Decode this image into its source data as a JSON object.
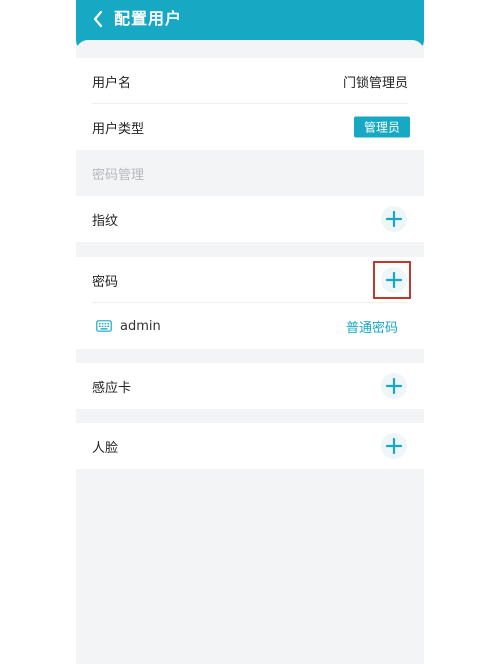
{
  "header": {
    "title": "配置用户",
    "back_icon": "chevron-left-icon"
  },
  "user_info": {
    "name_label": "用户名",
    "name_value": "门锁管理员",
    "type_label": "用户类型",
    "type_value": "管理员"
  },
  "password_management": {
    "section_title": "密码管理",
    "items": [
      {
        "label": "指纹",
        "action_icon": "plus-icon"
      },
      {
        "label": "密码",
        "action_icon": "plus-icon",
        "highlighted": true
      },
      {
        "label": "感应卡",
        "action_icon": "plus-icon"
      },
      {
        "label": "人脸",
        "action_icon": "plus-icon"
      }
    ],
    "password_entries": [
      {
        "icon": "keyboard-icon",
        "name": "admin",
        "type": "普通密码"
      }
    ]
  },
  "colors": {
    "accent": "#17a9c4",
    "background": "#f3f4f6",
    "highlight": "#c0392b"
  }
}
